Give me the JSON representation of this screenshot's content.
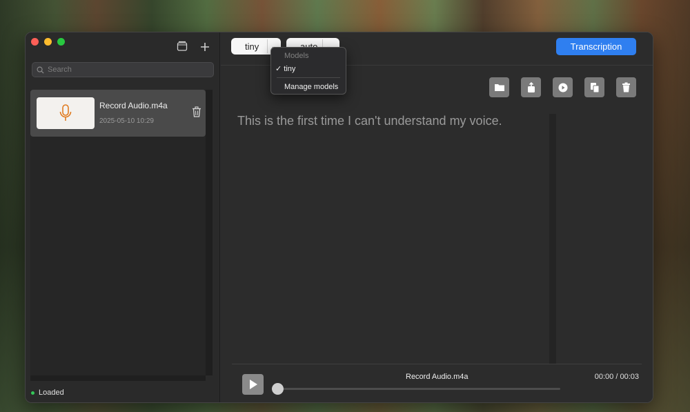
{
  "colors": {
    "accent": "#2f7ff0",
    "status_dot": "#35c759",
    "mic_icon": "#e07a1e"
  },
  "sidebar": {
    "search_placeholder": "Search",
    "tools": [
      "sidebar-toggle-icon",
      "plus-icon"
    ],
    "items": [
      {
        "title": "Record Audio.m4a",
        "date": "2025-05-10 10:29",
        "thumb_icon": "microphone-icon"
      }
    ],
    "status": "Loaded"
  },
  "toolbar": {
    "model_value": "tiny",
    "language_value": "auto",
    "transcribe_label": "Transcription"
  },
  "model_menu": {
    "header": "Models",
    "selected": "✓ tiny",
    "manage": "Manage models"
  },
  "actions": [
    "folder-icon",
    "share-icon",
    "play-circle-icon",
    "copy-icon",
    "trash-icon"
  ],
  "transcript": "This is the first time I can't understand my voice.",
  "player": {
    "file": "Record Audio.m4a",
    "time": "00:00 / 00:03",
    "progress": 0
  }
}
